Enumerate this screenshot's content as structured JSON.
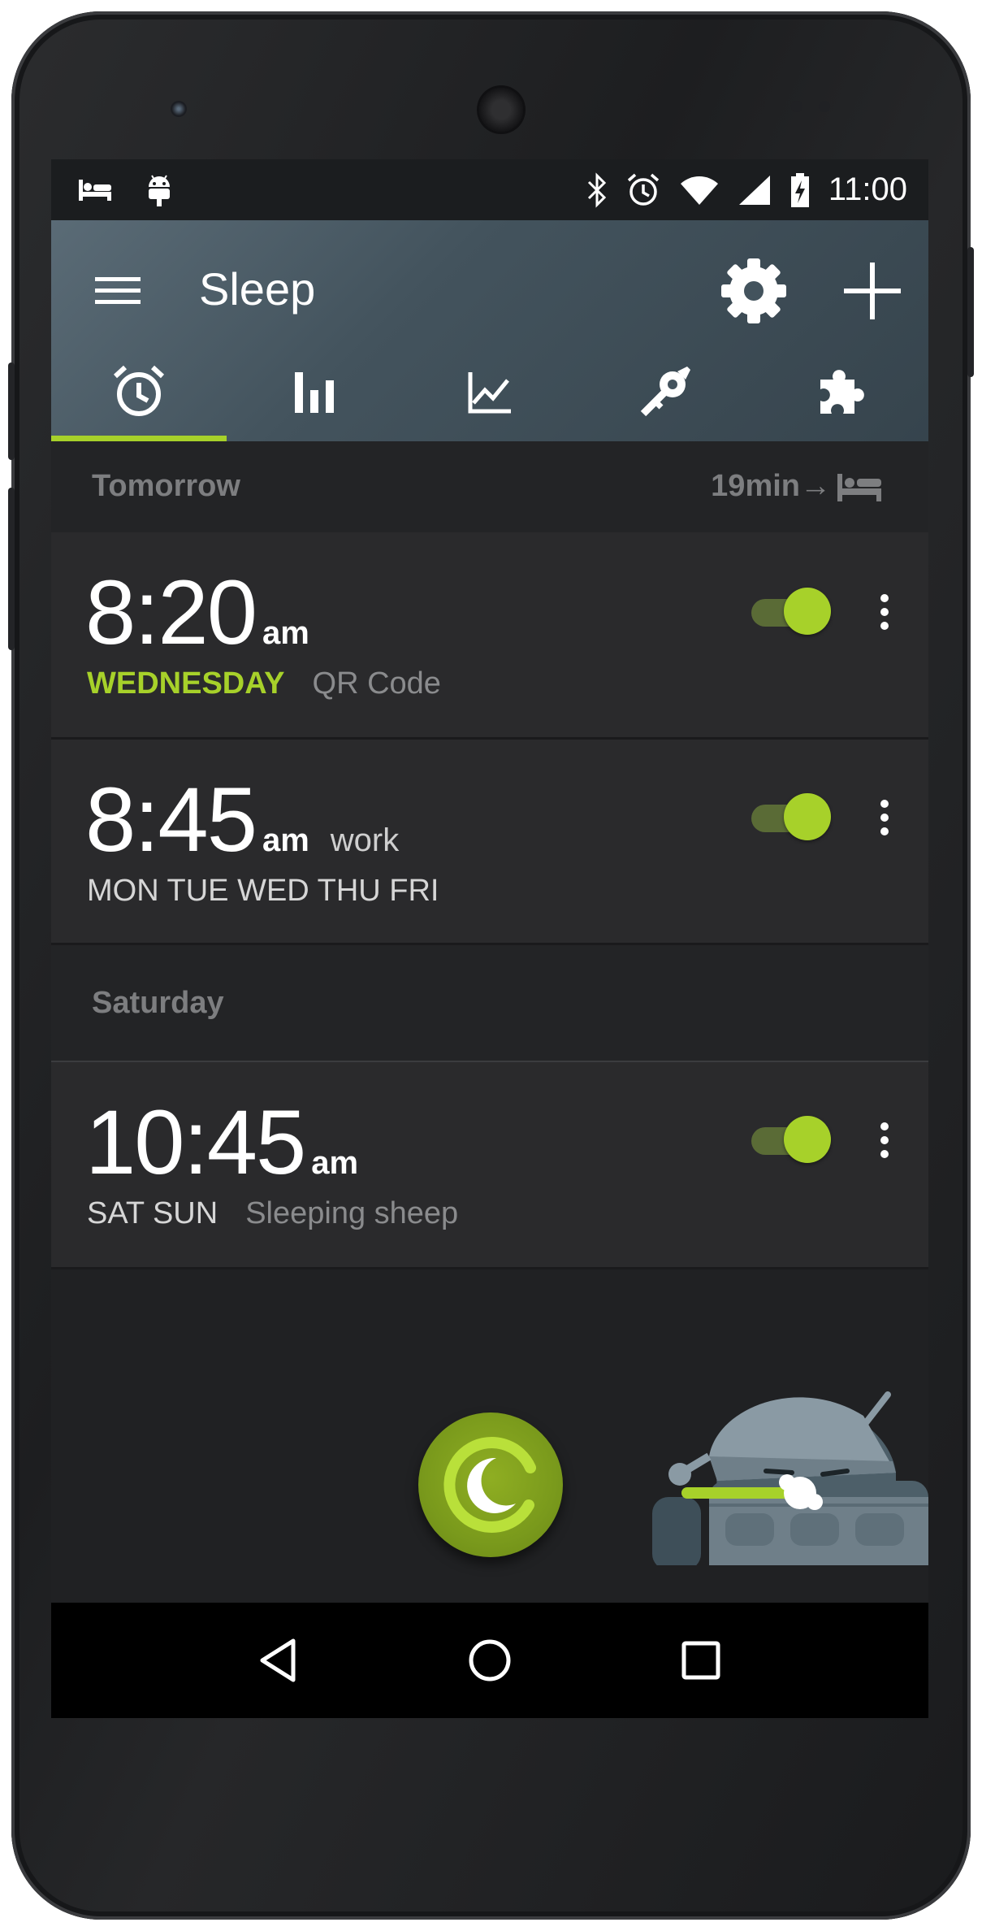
{
  "status_bar": {
    "time": "11:00",
    "left_icons": [
      "bed-icon",
      "android-icon"
    ],
    "right_icons": [
      "bluetooth-icon",
      "alarm-icon",
      "wifi-icon",
      "signal-icon",
      "battery-icon"
    ]
  },
  "app_bar": {
    "title": "Sleep",
    "menu_icon": "menu-icon",
    "settings_icon": "gear-icon",
    "add_icon": "plus-icon"
  },
  "tabs": [
    {
      "icon": "alarm-clock-icon",
      "active": true
    },
    {
      "icon": "bar-chart-icon",
      "active": false
    },
    {
      "icon": "trend-chart-icon",
      "active": false
    },
    {
      "icon": "tools-icon",
      "active": false
    },
    {
      "icon": "puzzle-icon",
      "active": false
    }
  ],
  "sections": [
    {
      "label": "Tomorrow",
      "info": "19min→",
      "alarms": [
        {
          "time": "8:20",
          "ampm": "am",
          "inline_label": "",
          "days": "WEDNESDAY",
          "days_accent": true,
          "sub_label": "QR Code",
          "enabled": true
        },
        {
          "time": "8:45",
          "ampm": "am",
          "inline_label": "work",
          "days": "MON TUE WED THU FRI",
          "days_accent": false,
          "sub_label": "",
          "enabled": true
        }
      ]
    },
    {
      "label": "Saturday",
      "info": "",
      "alarms": [
        {
          "time": "10:45",
          "ampm": "am",
          "inline_label": "",
          "days": "SAT SUN",
          "days_accent": false,
          "sub_label": "Sleeping sheep",
          "enabled": true
        }
      ]
    }
  ],
  "fab_icon": "moon-icon",
  "nav": [
    "back-icon",
    "home-icon",
    "recents-icon"
  ],
  "colors": {
    "accent": "#a7d12a",
    "appbar": "#43535d",
    "background": "#202123",
    "card": "#2a2a2c"
  }
}
